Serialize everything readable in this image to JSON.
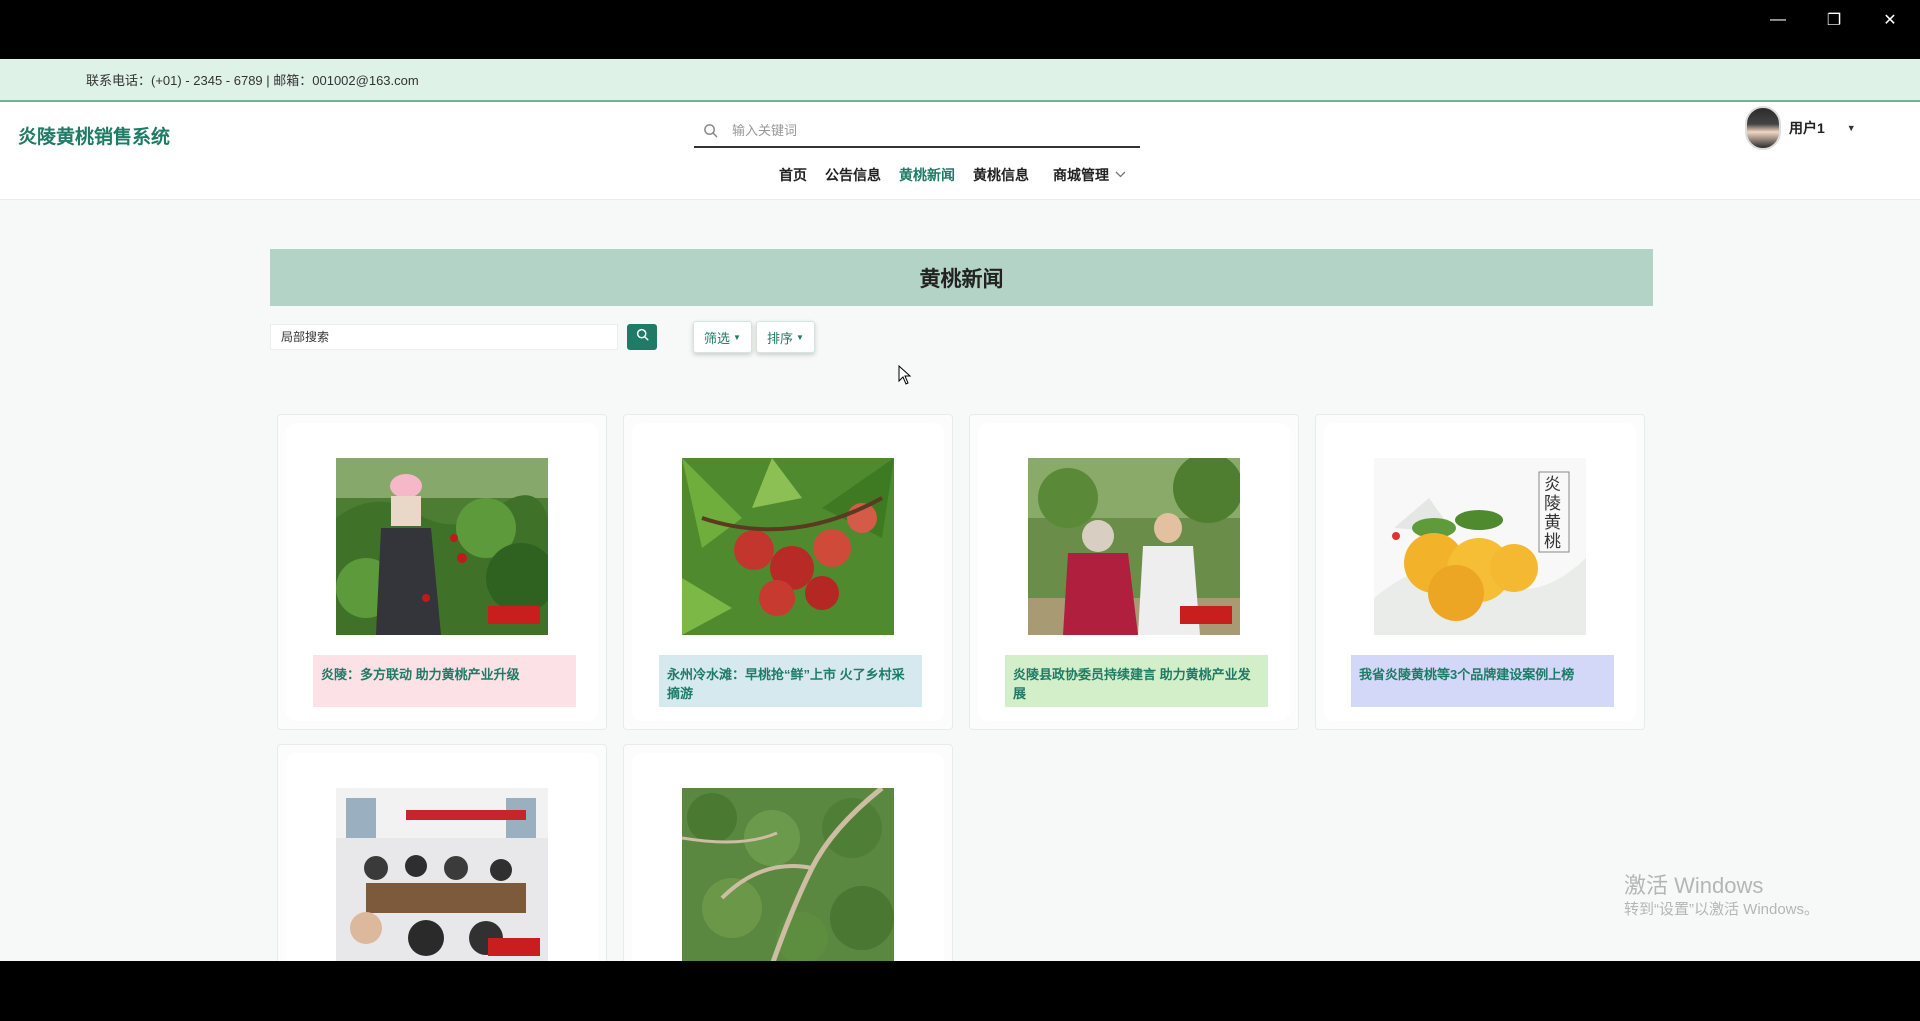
{
  "window_controls": {
    "minimize": "—",
    "maximize": "❐",
    "close": "✕"
  },
  "topbar": {
    "contact": "联系电话：(+01) - 2345 - 6789 | 邮箱：001002@163.com"
  },
  "header": {
    "brand": "炎陵黄桃销售系统",
    "search_placeholder": "输入关键词",
    "nav": [
      {
        "label": "首页"
      },
      {
        "label": "公告信息"
      },
      {
        "label": "黄桃新闻",
        "active": true
      },
      {
        "label": "黄桃信息"
      },
      {
        "label": "商城管理",
        "dropdown": true
      }
    ],
    "user": {
      "name": "用户1"
    }
  },
  "page": {
    "title": "黄桃新闻",
    "local_search_placeholder": "局部搜索",
    "filter_label": "筛选",
    "sort_label": "排序"
  },
  "news": [
    {
      "caption": "炎陵：多方联动 助力黄桃产业升级",
      "caption_bg": "#fce1e6",
      "image": "peach-orchard-woman-photo",
      "watermark": "红网时刻"
    },
    {
      "caption": "永州冷水滩：早桃抢“鲜”上市 火了乡村采摘游",
      "caption_bg": "#d6e9ef",
      "image": "red-peaches-on-branch-photo",
      "watermark": ""
    },
    {
      "caption": "炎陵县政协委员持续建言 助力黄桃产业发展",
      "caption_bg": "#d3efc9",
      "image": "farmers-in-orchard-photo",
      "watermark": "红网时刻"
    },
    {
      "caption": "我省炎陵黄桃等3个品牌建设案例上榜",
      "caption_bg": "#d3d8f8",
      "image": "yellow-peaches-poster",
      "watermark": ""
    },
    {
      "caption": "",
      "caption_bg": "#ffffff",
      "image": "meeting-room-photo",
      "watermark": "红网时刻"
    },
    {
      "caption": "",
      "caption_bg": "#ffffff",
      "image": "aerial-orchard-path-photo",
      "watermark": ""
    }
  ],
  "poster": {
    "vertical_text": "炎陵黄桃"
  },
  "os_watermark": {
    "line1": "激活 Windows",
    "line2": "转到“设置”以激活 Windows。"
  },
  "colors": {
    "brand": "#1e7b66",
    "banner": "#b3d3c7",
    "topbar": "#dff2e8"
  }
}
